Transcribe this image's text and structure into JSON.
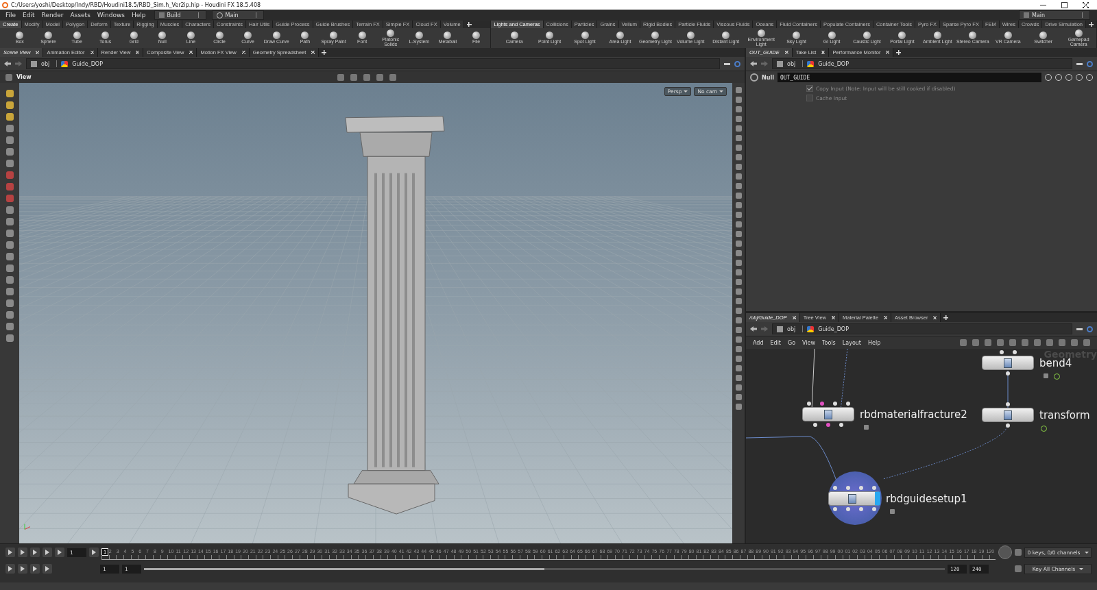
{
  "window": {
    "title": "C:/Users/yoshi/Desktop/Indy/RBD/Houdini18.5/RBD_Sim.h_Ver2ip.hip - Houdini FX 18.5.408"
  },
  "menu": [
    "File",
    "Edit",
    "Render",
    "Assets",
    "Windows",
    "Help"
  ],
  "desktop_select": "Build",
  "pane_layout_select": "Main",
  "right_select": "Main",
  "shelf_left": {
    "tabs": [
      {
        "label": "Create",
        "selected": true
      },
      {
        "label": "Modify",
        "selected": false
      },
      {
        "label": "Model",
        "selected": false
      },
      {
        "label": "Polygon",
        "selected": false
      },
      {
        "label": "Deform",
        "selected": false
      },
      {
        "label": "Texture",
        "selected": false
      },
      {
        "label": "Rigging",
        "selected": false
      },
      {
        "label": "Muscles",
        "selected": false
      },
      {
        "label": "Characters",
        "selected": false
      },
      {
        "label": "Constraints",
        "selected": false
      },
      {
        "label": "Hair Utils",
        "selected": false
      },
      {
        "label": "Guide Process",
        "selected": false
      },
      {
        "label": "Guide Brushes",
        "selected": false
      },
      {
        "label": "Terrain FX",
        "selected": false
      },
      {
        "label": "Simple FX",
        "selected": false
      },
      {
        "label": "Cloud FX",
        "selected": false
      },
      {
        "label": "Volume",
        "selected": false
      }
    ],
    "tools": [
      "Box",
      "Sphere",
      "Tube",
      "Torus",
      "Grid",
      "Null",
      "Line",
      "Circle",
      "Curve",
      "Draw Curve",
      "Path",
      "Spray Paint",
      "Font",
      "Platonic Solids",
      "L-System",
      "Metaball",
      "File"
    ]
  },
  "shelf_right": {
    "tabs": [
      {
        "label": "Lights and Cameras",
        "selected": true
      },
      {
        "label": "Collisions",
        "selected": false
      },
      {
        "label": "Particles",
        "selected": false
      },
      {
        "label": "Grains",
        "selected": false
      },
      {
        "label": "Vellum",
        "selected": false
      },
      {
        "label": "Rigid Bodies",
        "selected": false
      },
      {
        "label": "Particle Fluids",
        "selected": false
      },
      {
        "label": "Viscous Fluids",
        "selected": false
      },
      {
        "label": "Oceans",
        "selected": false
      },
      {
        "label": "Fluid Containers",
        "selected": false
      },
      {
        "label": "Populate Containers",
        "selected": false
      },
      {
        "label": "Container Tools",
        "selected": false
      },
      {
        "label": "Pyro FX",
        "selected": false
      },
      {
        "label": "Sparse Pyro FX",
        "selected": false
      },
      {
        "label": "FEM",
        "selected": false
      },
      {
        "label": "Wires",
        "selected": false
      },
      {
        "label": "Crowds",
        "selected": false
      },
      {
        "label": "Drive Simulation",
        "selected": false
      }
    ],
    "tools": [
      "Camera",
      "Point Light",
      "Spot Light",
      "Area Light",
      "Geometry Light",
      "Volume Light",
      "Distant Light",
      "Environment Light",
      "Sky Light",
      "GI Light",
      "Caustic Light",
      "Portal Light",
      "Ambient Light",
      "Stereo Camera",
      "VR Camera",
      "Switcher",
      "Gamepad Camera"
    ]
  },
  "scene_pane": {
    "tabs": [
      {
        "label": "Scene View",
        "selected": true
      },
      {
        "label": "Animation Editor",
        "selected": false
      },
      {
        "label": "Render View",
        "selected": false
      },
      {
        "label": "Composite View",
        "selected": false
      },
      {
        "label": "Motion FX View",
        "selected": false
      },
      {
        "label": "Geometry Spreadsheet",
        "selected": false
      }
    ],
    "path": [
      "obj",
      "Guide_DOP"
    ],
    "viewport_title": "View",
    "view_buttons": [
      "Persp",
      "No cam"
    ]
  },
  "params_pane": {
    "tabs": [
      {
        "label": "OUT_GUIDE",
        "selected": true
      },
      {
        "label": "Take List",
        "selected": false
      },
      {
        "label": "Performance Monitor",
        "selected": false
      }
    ],
    "path": [
      "obj",
      "Guide_DOP"
    ],
    "node_type": "Null",
    "node_name": "OUT_GUIDE",
    "params": [
      {
        "label": "Copy Input (Note: Input will be still cooked if disabled)",
        "checked": true
      },
      {
        "label": "Cache Input",
        "checked": false
      }
    ]
  },
  "network_pane": {
    "tabs": [
      {
        "label": "/obj/Guide_DOP",
        "selected": true
      },
      {
        "label": "Tree View",
        "selected": false
      },
      {
        "label": "Material Palette",
        "selected": false
      },
      {
        "label": "Asset Browser",
        "selected": false
      }
    ],
    "path": [
      "obj",
      "Guide_DOP"
    ],
    "menu": [
      "Add",
      "Edit",
      "Go",
      "View",
      "Tools",
      "Layout",
      "Help"
    ],
    "context_label": "Geometry",
    "nodes": [
      {
        "name": "bend4",
        "selected": false
      },
      {
        "name": "rbdmaterialfracture2",
        "selected": false
      },
      {
        "name": "transform",
        "selected": false
      },
      {
        "name": "rbdguidesetup1",
        "selected": true
      }
    ]
  },
  "timeline": {
    "frame_field": "1",
    "current_frame": "1",
    "ticks": [
      "2",
      "3",
      "4",
      "5",
      "6",
      "7",
      "8",
      "9",
      "10",
      "11",
      "12",
      "13",
      "14",
      "15",
      "16",
      "17",
      "18",
      "19",
      "20",
      "21",
      "22",
      "23",
      "24",
      "25",
      "26",
      "27",
      "28",
      "29",
      "30",
      "31",
      "32",
      "33",
      "34",
      "35",
      "36",
      "37",
      "38",
      "39",
      "40",
      "41",
      "42",
      "43",
      "44",
      "45",
      "46",
      "47",
      "48",
      "49",
      "50",
      "51",
      "52",
      "53",
      "54",
      "55",
      "56",
      "57",
      "58",
      "59",
      "60",
      "61",
      "62",
      "63",
      "64",
      "65",
      "66",
      "67",
      "68",
      "69",
      "70",
      "71",
      "72",
      "73",
      "74",
      "75",
      "76",
      "77",
      "78",
      "79",
      "80",
      "81",
      "82",
      "83",
      "84",
      "85",
      "86",
      "87",
      "88",
      "89",
      "90",
      "91",
      "92",
      "93",
      "94",
      "95",
      "96",
      "97",
      "98",
      "99",
      "00",
      "01",
      "02",
      "03",
      "04",
      "05",
      "06",
      "07",
      "08",
      "09",
      "10",
      "11",
      "12",
      "13",
      "14",
      "15",
      "16",
      "17",
      "18",
      "19",
      "120"
    ],
    "start": "1",
    "range_start": "1",
    "range_slider": {
      "level": 0.5
    },
    "range_end": "120",
    "end": "240",
    "keys_status": "0 keys, 0/0 channels",
    "key_mode": "Key All Channels"
  }
}
